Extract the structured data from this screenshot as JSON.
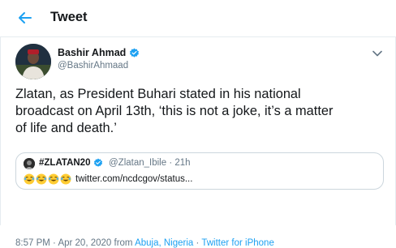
{
  "header": {
    "title": "Tweet",
    "back_icon": "arrow-left-icon"
  },
  "tweet": {
    "author_name": "Bashir Ahmad",
    "author_handle": "@BashirAhmaad",
    "text": "Zlatan, as President Buhari stated in his national\nbroadcast on April 13th, ‘this is not a joke, it’s a matter\nof life and death.’",
    "time": "8:57 PM",
    "date": "Apr 20, 2020",
    "from_label": "from",
    "location_city": "Abuja",
    "location_country": "Nigeria",
    "separator": "·",
    "source": "Twitter for iPhone"
  },
  "quoted": {
    "author_name": "#ZLATAN20",
    "author_handle": "@Zlatan_Ibile",
    "age": "21h",
    "link_text": "twitter.com/ncdcgov/status...",
    "emoji_count": 4
  },
  "colors": {
    "accent": "#1da1f2",
    "text": "#14171a",
    "muted": "#657786",
    "border": "#e6ecf0"
  }
}
